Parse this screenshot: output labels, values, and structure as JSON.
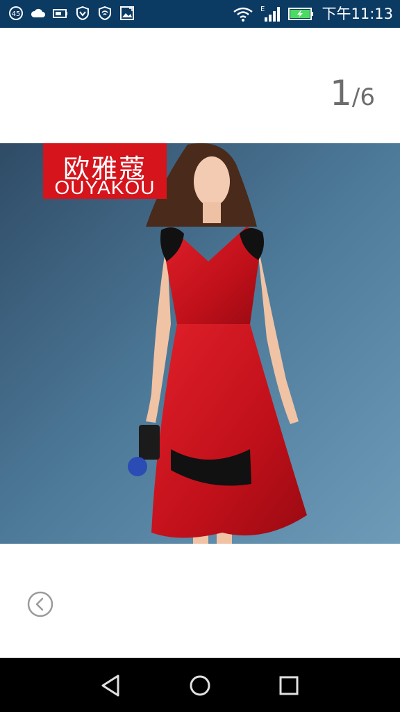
{
  "status_bar": {
    "time": "下午11:13",
    "notification_badge": "45",
    "left_icons": [
      "notification-badge-icon",
      "cloud-icon",
      "battery-saver-icon",
      "shield-icon",
      "wifi-shield-icon",
      "image-icon"
    ],
    "right_icons": [
      "wifi-icon",
      "signal-icon",
      "battery-icon"
    ],
    "network_label": "E",
    "background_color": "#0b3a63"
  },
  "gallery": {
    "current_index": "1",
    "separator": "/",
    "total": "6",
    "brand_name_cn": "欧雅蔻",
    "brand_name_en": "OUYAKOU"
  },
  "navigation": {
    "prev_icon": "chevron-left-circle-icon",
    "back_icon": "back-triangle-icon",
    "home_icon": "home-circle-icon",
    "recent_icon": "recent-square-icon"
  }
}
